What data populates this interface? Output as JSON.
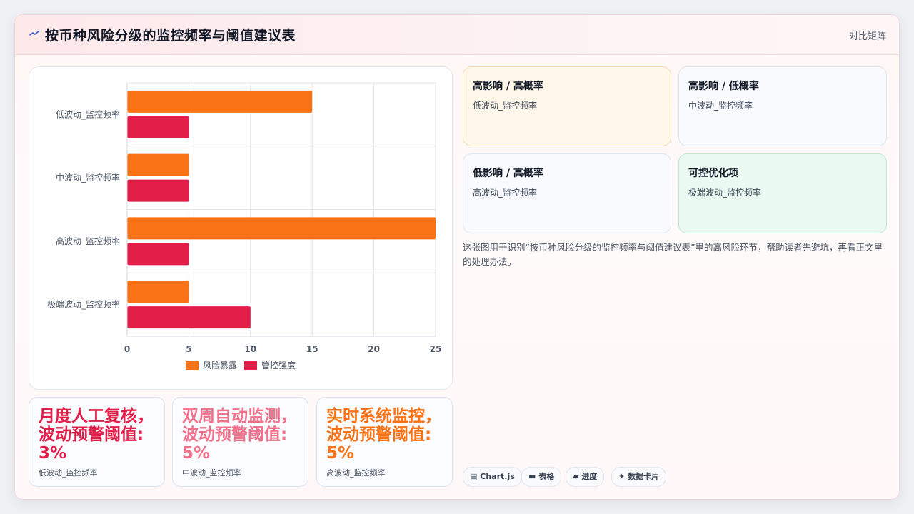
{
  "header": {
    "icon": "trend-wave-icon",
    "title": "按币种风险分级的监控频率与阈值建议表",
    "switch_label": "对比矩阵"
  },
  "colors": {
    "exposure": "#f97316",
    "control": "#e11d48",
    "stat1": "#e11d48",
    "stat2": "#f0708a",
    "stat3": "#f97316"
  },
  "chart_data": {
    "type": "bar",
    "orientation": "horizontal",
    "categories": [
      "低波动_监控频率",
      "中波动_监控频率",
      "高波动_监控频率",
      "极端波动_监控频率"
    ],
    "series": [
      {
        "name": "风险暴露",
        "values": [
          15,
          5,
          25,
          5
        ]
      },
      {
        "name": "管控强度",
        "values": [
          5,
          5,
          5,
          10
        ]
      }
    ],
    "xlim": [
      0,
      25
    ],
    "xticks": [
      "0",
      "5",
      "10",
      "15",
      "20",
      "25"
    ],
    "grid": true,
    "legend": "bottom"
  },
  "stats": [
    {
      "value": "月度人工复核，波动预警阈值: 3%",
      "label": "低波动_监控频率"
    },
    {
      "value": "双周自动监测，波动预警阈值: 5%",
      "label": "中波动_监控频率"
    },
    {
      "value": "实时系统监控，波动预警阈值: 5%",
      "label": "高波动_监控频率"
    }
  ],
  "matrix": [
    {
      "title": "高影响 / 高概率",
      "item": "低波动_监控频率"
    },
    {
      "title": "高影响 / 低概率",
      "item": "中波动_监控频率"
    },
    {
      "title": "低影响 / 高概率",
      "item": "高波动_监控频率"
    },
    {
      "title": "可控优化项",
      "item": "极端波动_监控频率"
    }
  ],
  "note": "这张图用于识别“按币种风险分级的监控频率与阈值建议表”里的高风险环节，帮助读者先避坑，再看正文里的处理办法。",
  "tags": [
    {
      "icon": "chart-icon",
      "glyph": "▤",
      "label": "Chart.js"
    },
    {
      "icon": "table-icon",
      "glyph": "▬",
      "label": "表格"
    },
    {
      "icon": "progress-icon",
      "glyph": "▰",
      "label": "进度"
    },
    {
      "icon": "sparkle-icon",
      "glyph": "✦",
      "label": "数据卡片"
    }
  ]
}
